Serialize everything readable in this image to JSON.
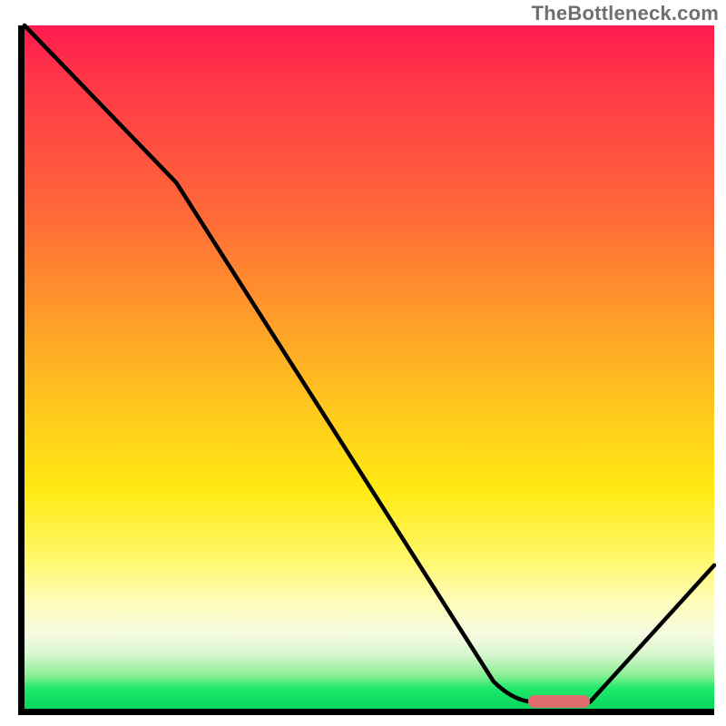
{
  "watermark": "TheBottleneck.com",
  "chart_data": {
    "type": "line",
    "title": "",
    "xlabel": "",
    "ylabel": "",
    "xlim": [
      0,
      100
    ],
    "ylim": [
      0,
      100
    ],
    "grid": false,
    "legend": false,
    "series": [
      {
        "name": "bottleneck-curve",
        "x": [
          0,
          22,
          68,
          74,
          82,
          100
        ],
        "y": [
          100,
          77,
          4,
          1,
          1,
          21
        ],
        "color": "#000000",
        "stroke_width": 4
      }
    ],
    "marker": {
      "name": "optimal-range",
      "x_start": 73,
      "x_end": 82,
      "y": 1,
      "color": "#e06e6e"
    },
    "background_gradient": {
      "direction": "vertical",
      "stops": [
        {
          "pct": 0,
          "color": "#ff1a4e"
        },
        {
          "pct": 8,
          "color": "#ff3648"
        },
        {
          "pct": 28,
          "color": "#ff6a38"
        },
        {
          "pct": 42,
          "color": "#ff9a2a"
        },
        {
          "pct": 56,
          "color": "#ffc81e"
        },
        {
          "pct": 68,
          "color": "#ffe912"
        },
        {
          "pct": 78,
          "color": "#fff86a"
        },
        {
          "pct": 84,
          "color": "#fffcb6"
        },
        {
          "pct": 89,
          "color": "#f6fbe0"
        },
        {
          "pct": 92,
          "color": "#d8f7d0"
        },
        {
          "pct": 95,
          "color": "#8def96"
        },
        {
          "pct": 97,
          "color": "#21e96b"
        },
        {
          "pct": 100,
          "color": "#05d65b"
        }
      ]
    }
  },
  "geometry": {
    "plot_inner_w": 760,
    "plot_inner_h": 753
  }
}
